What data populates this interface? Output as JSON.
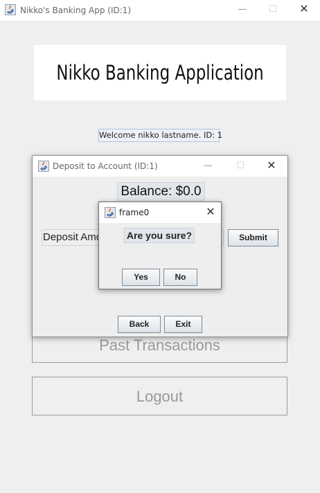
{
  "main_window": {
    "title": "Nikko's Banking App (ID:1)",
    "header": "Nikko Banking Application",
    "welcome": "Welcome nikko lastname. ID: 1",
    "buttons": {
      "past_transactions": "Past Transactions",
      "logout": "Logout"
    },
    "controls": {
      "minimize": "—",
      "maximize": "☐",
      "close": "✕"
    }
  },
  "deposit_window": {
    "title": "Deposit to Account (ID:1)",
    "balance": "Balance: $0.0",
    "deposit_label": "Deposit Amount",
    "submit": "Submit",
    "back": "Back",
    "exit": "Exit"
  },
  "confirm_dialog": {
    "title": "frame0",
    "question": "Are you sure?",
    "yes": "Yes",
    "no": "No"
  },
  "icons": {
    "app": "java-icon"
  }
}
